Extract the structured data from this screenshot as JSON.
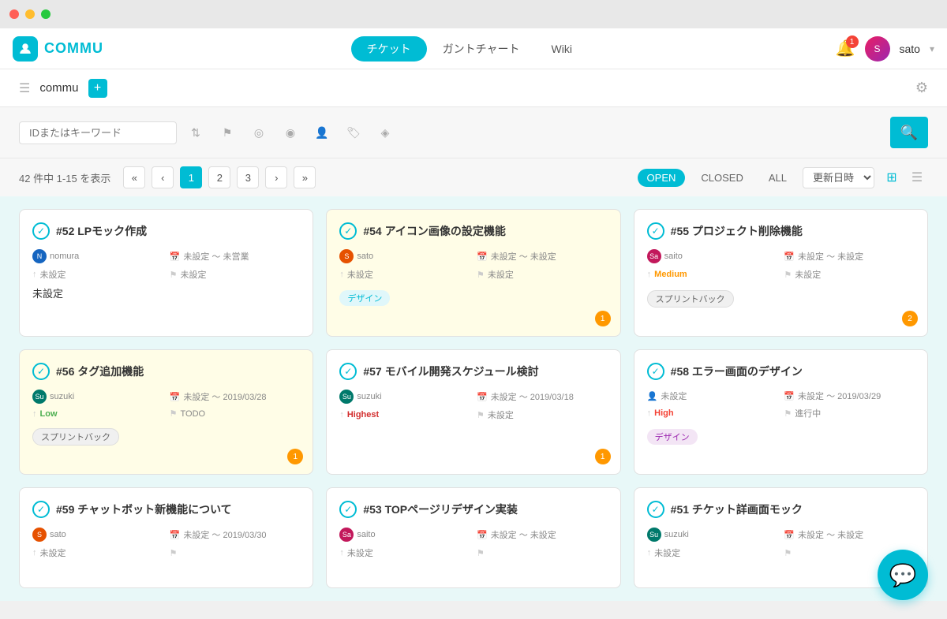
{
  "titlebar": {
    "buttons": [
      "red",
      "yellow",
      "green"
    ]
  },
  "header": {
    "logo_text": "COMMU",
    "nav_tabs": [
      {
        "label": "チケット",
        "active": true
      },
      {
        "label": "ガントチャート",
        "active": false
      },
      {
        "label": "Wiki",
        "active": false
      }
    ],
    "notif_count": "1",
    "user_name": "sato",
    "user_initials": "S"
  },
  "sub_header": {
    "project_name": "commu",
    "add_label": "+",
    "gear_label": "⚙"
  },
  "toolbar": {
    "search_placeholder": "IDまたはキーワード",
    "search_btn_label": "🔍"
  },
  "pagination": {
    "count_text": "42 件中 1-15 を表示",
    "pages": [
      "<<",
      "<",
      "1",
      "2",
      "3",
      ">",
      ">>"
    ],
    "active_page": "1",
    "status_open": "OPEN",
    "status_closed": "CLOSED",
    "status_all": "ALL",
    "sort_label": "更新日時"
  },
  "tickets": [
    {
      "id": "#52",
      "title": "LPモック作成",
      "assignee": "nomura",
      "av_class": "av-blue",
      "av_initials": "N",
      "date_range": "未設定 〜 未営業",
      "priority": "",
      "priority_label": "未設定",
      "priority_class": "",
      "status": "未設定",
      "tag": "未設定",
      "tag_class": "",
      "comment_count": "",
      "highlighted": false
    },
    {
      "id": "#54",
      "title": "アイコン画像の設定機能",
      "assignee": "sato",
      "av_class": "av-orange",
      "av_initials": "S",
      "date_range": "未設定 〜 未設定",
      "priority": "",
      "priority_label": "未設定",
      "priority_class": "",
      "status": "未設定",
      "tag": "デザイン",
      "tag_class": "card-tag",
      "comment_count": "1",
      "highlighted": true
    },
    {
      "id": "#55",
      "title": "プロジェクト削除機能",
      "assignee": "saito",
      "av_class": "av-pink",
      "av_initials": "Sa",
      "date_range": "未設定 〜 未設定",
      "priority": "Medium",
      "priority_label": "Medium",
      "priority_class": "priority-medium",
      "status": "未設定",
      "tag": "スプリントバック",
      "tag_class": "card-tag sprint",
      "comment_count": "2",
      "highlighted": false
    },
    {
      "id": "#56",
      "title": "タグ追加機能",
      "assignee": "suzuki",
      "av_class": "av-teal",
      "av_initials": "Su",
      "date_range": "未設定 〜 2019/03/28",
      "priority": "Low",
      "priority_label": "Low",
      "priority_class": "priority-low",
      "status": "TODO",
      "tag": "スプリントバック",
      "tag_class": "card-tag sprint",
      "comment_count": "1",
      "highlighted": true
    },
    {
      "id": "#57",
      "title": "モバイル開発スケジュール検討",
      "assignee": "suzuki",
      "av_class": "av-teal",
      "av_initials": "Su",
      "date_range": "未設定 〜 2019/03/18",
      "priority": "Highest",
      "priority_label": "Highest",
      "priority_class": "priority-highest",
      "status": "未設定",
      "tag": "",
      "tag_class": "",
      "comment_count": "1",
      "highlighted": false
    },
    {
      "id": "#58",
      "title": "エラー画面のデザイン",
      "assignee": "未設定",
      "av_class": "",
      "av_initials": "",
      "date_range": "未設定 〜 2019/03/29",
      "priority": "High",
      "priority_label": "High",
      "priority_class": "priority-high",
      "status": "進行中",
      "tag": "デザイン",
      "tag_class": "card-tag purple",
      "comment_count": "",
      "highlighted": false
    },
    {
      "id": "#59",
      "title": "チャットボット新機能について",
      "assignee": "sato",
      "av_class": "av-orange",
      "av_initials": "S",
      "date_range": "未設定 〜 2019/03/30",
      "priority": "",
      "priority_label": "",
      "priority_class": "",
      "status": "",
      "tag": "",
      "tag_class": "",
      "comment_count": "",
      "highlighted": false
    },
    {
      "id": "#53",
      "title": "TOPページリデザイン実装",
      "assignee": "saito",
      "av_class": "av-pink",
      "av_initials": "Sa",
      "date_range": "未設定 〜 未設定",
      "priority": "",
      "priority_label": "",
      "priority_class": "",
      "status": "",
      "tag": "",
      "tag_class": "",
      "comment_count": "",
      "highlighted": false
    },
    {
      "id": "#51",
      "title": "チケット詳画面モック",
      "assignee": "suzuki",
      "av_class": "av-teal",
      "av_initials": "Su",
      "date_range": "未設定 〜 未設定",
      "priority": "",
      "priority_label": "",
      "priority_class": "",
      "status": "",
      "tag": "",
      "tag_class": "",
      "comment_count": "",
      "highlighted": false
    }
  ]
}
